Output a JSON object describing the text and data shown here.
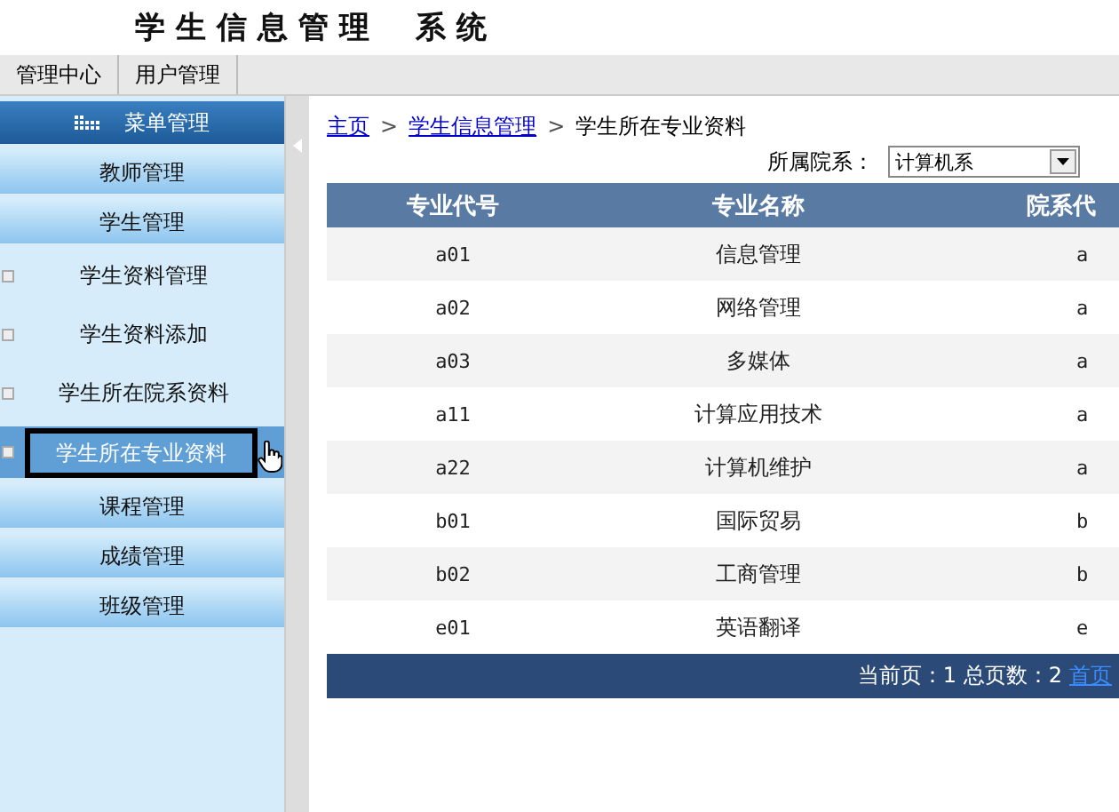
{
  "header": {
    "title": "学生信息管理 系统"
  },
  "nav_tabs": [
    {
      "label": "管理中心",
      "selected": false
    },
    {
      "label": "用户管理",
      "selected": false
    }
  ],
  "sidebar": {
    "title": "菜单管理",
    "items": [
      {
        "kind": "group",
        "label": "教师管理"
      },
      {
        "kind": "group",
        "label": "学生管理",
        "children": [
          {
            "label": "学生资料管理",
            "selected": false
          },
          {
            "label": "学生资料添加",
            "selected": false
          },
          {
            "label": "学生所在院系资料",
            "selected": false
          },
          {
            "label": "学生所在专业资料",
            "selected": true
          }
        ]
      },
      {
        "kind": "group",
        "label": "课程管理"
      },
      {
        "kind": "group",
        "label": "成绩管理"
      },
      {
        "kind": "group",
        "label": "班级管理"
      }
    ]
  },
  "breadcrumb": {
    "separator": ">",
    "items": [
      {
        "kind": "link",
        "label": "主页"
      },
      {
        "kind": "link",
        "label": "学生信息管理"
      },
      {
        "kind": "current",
        "label": "学生所在专业资料"
      }
    ]
  },
  "filter": {
    "label": "所属院系：",
    "value": "计算机系"
  },
  "table": {
    "columns": [
      "专业代号",
      "专业名称",
      "院系代"
    ],
    "rows": [
      [
        "a01",
        "信息管理",
        "a"
      ],
      [
        "a02",
        "网络管理",
        "a"
      ],
      [
        "a03",
        "多媒体",
        "a"
      ],
      [
        "a11",
        "计算应用技术",
        "a"
      ],
      [
        "a22",
        "计算机维护",
        "a"
      ],
      [
        "b01",
        "国际贸易",
        "b"
      ],
      [
        "b02",
        "工商管理",
        "b"
      ],
      [
        "e01",
        "英语翻译",
        "e"
      ]
    ]
  },
  "pagination": {
    "text": "当前页：1 总页数：2",
    "link": "首页"
  }
}
